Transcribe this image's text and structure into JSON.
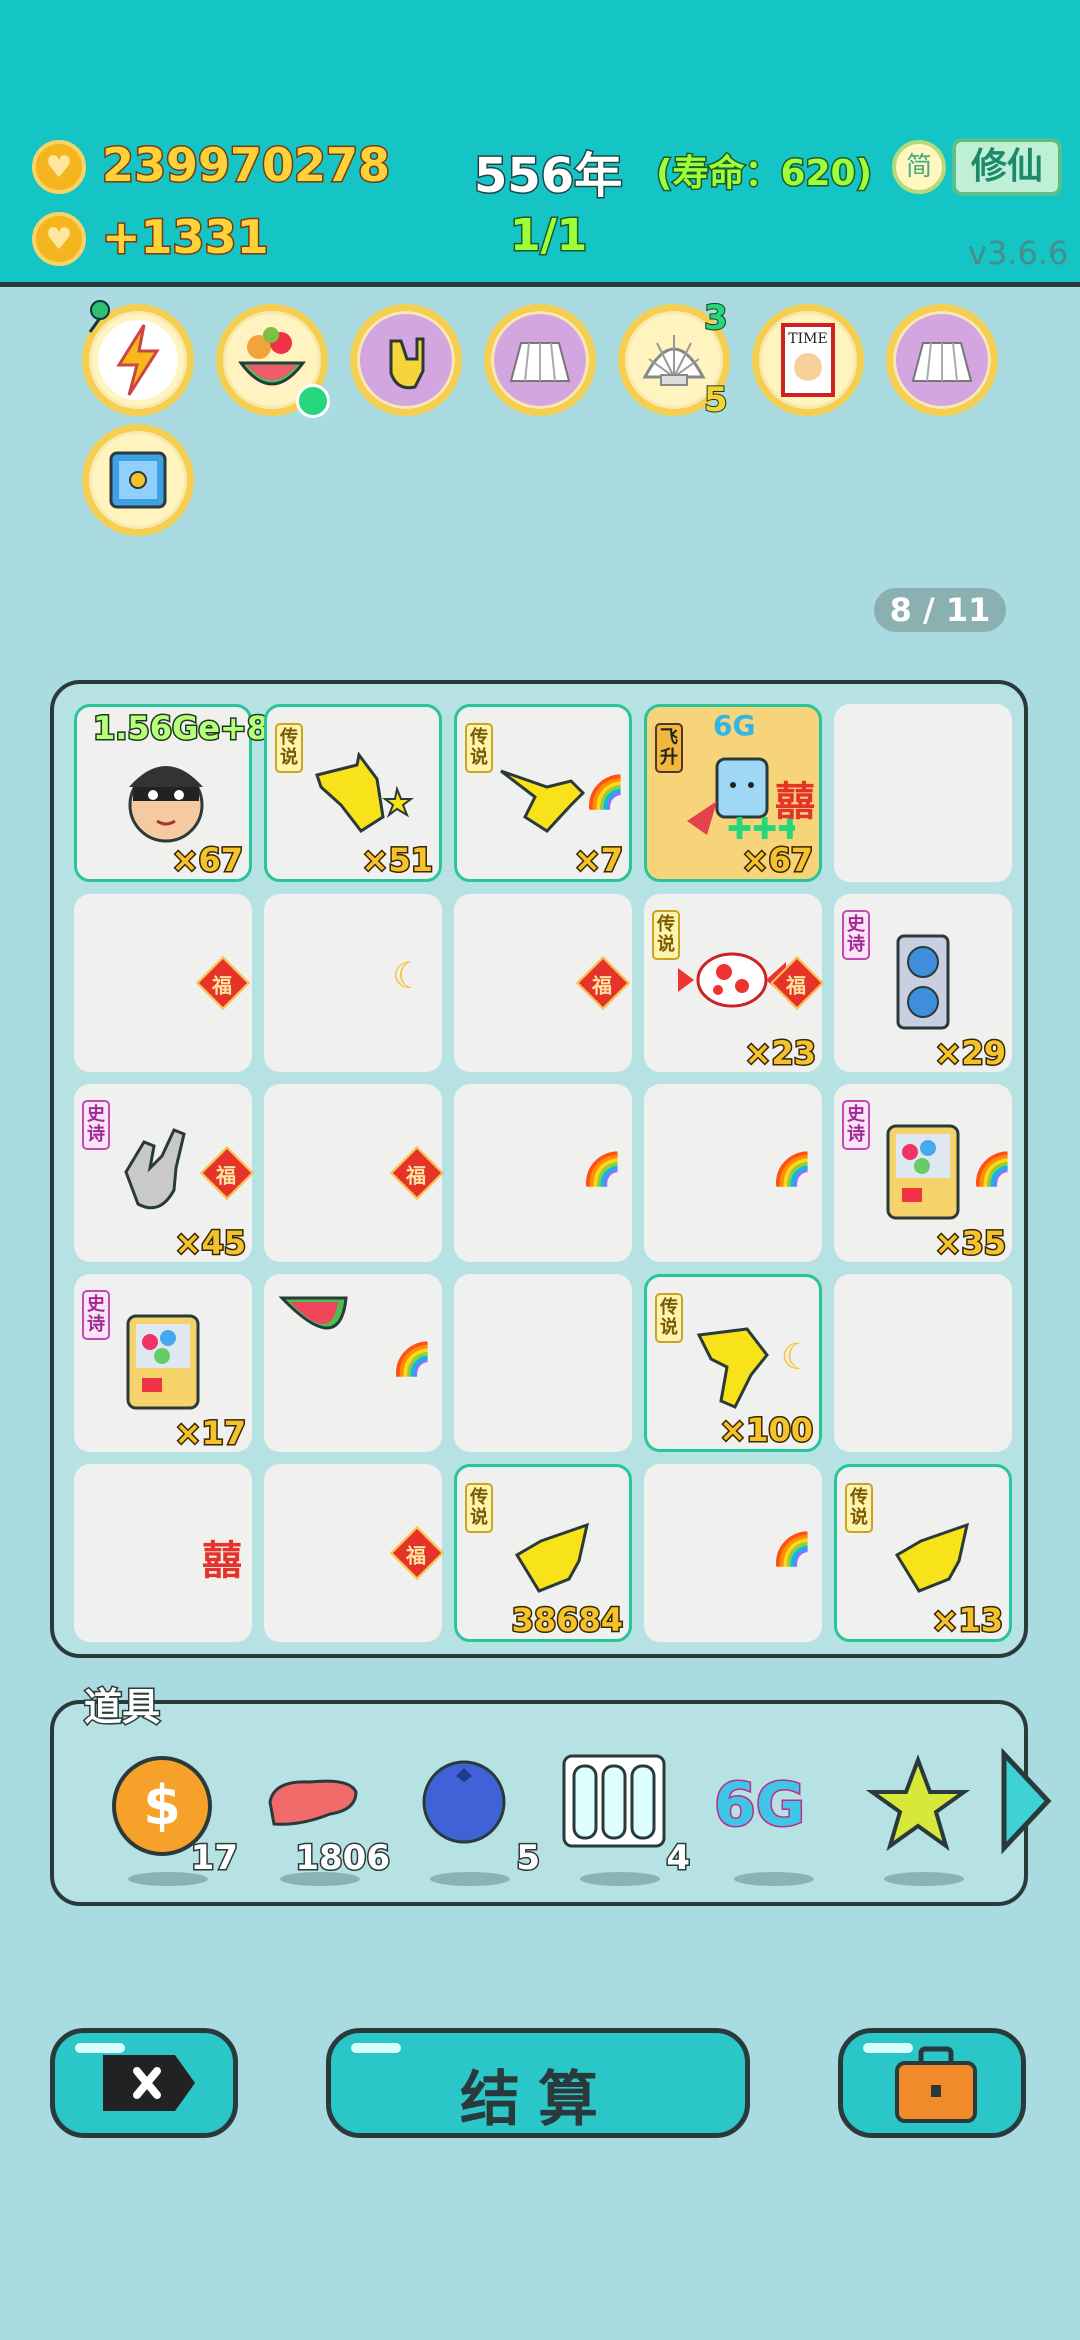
{
  "header": {
    "coins": "239970278",
    "coin_rate": "+1331",
    "year": "556年",
    "lifespan": "(寿命：620)",
    "progress": "1/1",
    "simplified_label": "简",
    "cultivate_label": "修仙",
    "version": "v3.6.6"
  },
  "buffs": {
    "shell_count_top": "3",
    "shell_count_bottom": "5",
    "time_label": "TIME"
  },
  "page_indicator": "8 / 11",
  "tags": {
    "legend": "传说",
    "epic": "史诗",
    "fly": "飞升"
  },
  "board": {
    "c00_label": "1.56Ge+8",
    "c00_count": "×67",
    "c01_count": "×51",
    "c02_count": "×7",
    "c03_label": "6G",
    "c03_count": "×67",
    "c13_count": "×23",
    "c14_count": "×29",
    "c20_count": "×45",
    "c24_count": "×35",
    "c30_count": "×17",
    "c33_count": "×100",
    "c42_count": "38684",
    "c44_count": "×13",
    "fu": "福",
    "xi": "囍"
  },
  "items": {
    "title": "道具",
    "coin_count": "17",
    "liver_count": "1806",
    "berry_count": "5",
    "tubes_count": "4",
    "sixg_label": "6G"
  },
  "buttons": {
    "settle": "结算"
  },
  "colors": {
    "header_bg": "#15c4c5",
    "board_bg": "#b6e2e3",
    "button": "#2bc6c8"
  }
}
